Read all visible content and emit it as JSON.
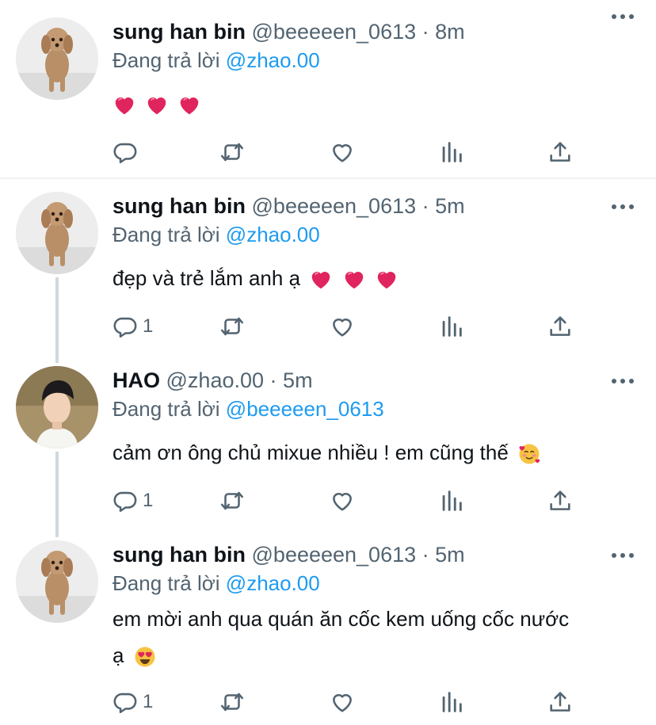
{
  "reply_prefix": "Đang trả lời",
  "tweets": [
    {
      "name": "sung han bin",
      "handle": "@beeeeen_0613",
      "separator": "·",
      "time": "8m",
      "reply_to": "@zhao.00",
      "text": "",
      "emoji_trailing": [
        "red-heart",
        "red-heart",
        "red-heart"
      ],
      "reply_count": "",
      "avatar": "poodle-avatar"
    },
    {
      "name": "sung han bin",
      "handle": "@beeeeen_0613",
      "separator": "·",
      "time": "5m",
      "reply_to": "@zhao.00",
      "text": "đẹp và trẻ lắm anh ạ",
      "emoji_trailing": [
        "red-heart",
        "red-heart",
        "red-heart"
      ],
      "reply_count": "1",
      "avatar": "poodle-avatar"
    },
    {
      "name": "HAO",
      "handle": "@zhao.00",
      "separator": "·",
      "time": "5m",
      "reply_to": "@beeeeen_0613",
      "text": "cảm ơn ông chủ mixue nhiều ! em cũng thế",
      "emoji_trailing": [
        "smiling-face-with-hearts"
      ],
      "reply_count": "1",
      "avatar": "person-avatar"
    },
    {
      "name": "sung han bin",
      "handle": "@beeeeen_0613",
      "separator": "·",
      "time": "5m",
      "reply_to": "@zhao.00",
      "text_line1": "em mời anh qua quán ăn cốc kem uống cốc nước",
      "text_line2": "ạ",
      "emoji_trailing": [
        "heart-eyes"
      ],
      "reply_count": "1",
      "avatar": "poodle-avatar"
    }
  ],
  "colors": {
    "text": "#0f1419",
    "secondary": "#536471",
    "link": "#1d9bf0",
    "divider": "#eff3f4",
    "thread_line": "#cfd9de",
    "heart_emoji": "#e0245e"
  },
  "icons": [
    "reply-icon",
    "retweet-icon",
    "like-icon",
    "analytics-icon",
    "share-icon",
    "more-icon"
  ]
}
